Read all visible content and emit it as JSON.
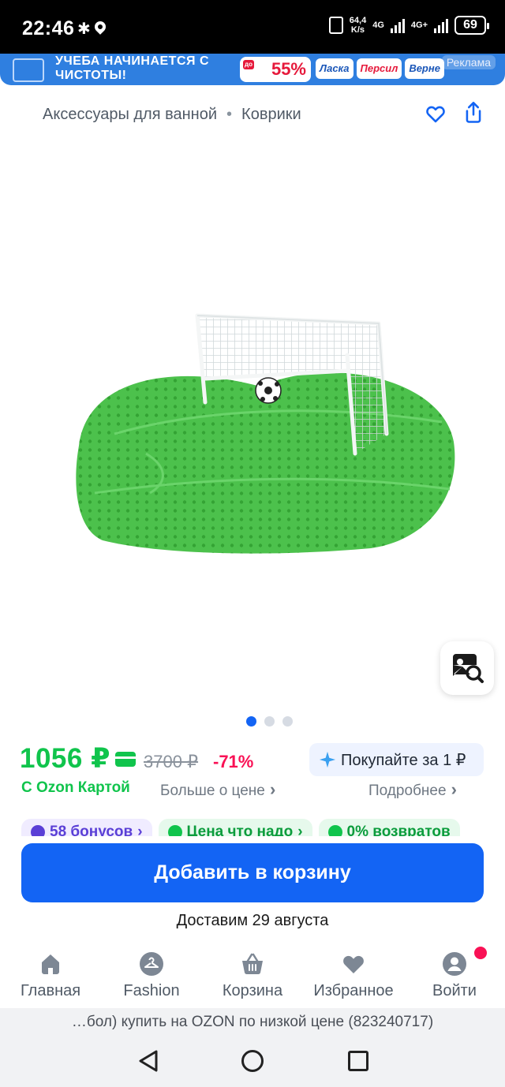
{
  "status_bar": {
    "time": "22:46",
    "net_speed_value": "64,4",
    "net_speed_unit": "K/s",
    "network1": "4G",
    "network2": "4G+",
    "battery": "69"
  },
  "ad_banner": {
    "headline": "УЧЕБА НАЧИНАЕТСЯ С ЧИСТОТЫ!",
    "promo_prefix": "до",
    "promo": "55%",
    "brands": [
      "Ласка",
      "Персил",
      "Верне"
    ],
    "label": "Реклама",
    "colors": {
      "background": "#2f7fe0",
      "promo": "#e6193b"
    }
  },
  "breadcrumb": {
    "items": [
      "Аксессуары для ванной",
      "Коврики"
    ]
  },
  "gallery": {
    "image_description_icon": "urinal-screen-football-goal",
    "dots_total": 3,
    "active_dot": 0
  },
  "price": {
    "current": "1056 ₽",
    "old": "3700 ₽",
    "discount": "-71%",
    "card_label": "С Ozon Картой",
    "more_about_price": "Больше о цене",
    "buy_for_label": "Покупайте за 1 ₽",
    "details_label": "Подробнее",
    "colors": {
      "price": "#10c44c",
      "discount": "#f91155",
      "accent": "#1364f4"
    }
  },
  "chips": [
    {
      "label": "58 бонусов",
      "style": "bonus"
    },
    {
      "label": "Цена что надо",
      "style": "good"
    },
    {
      "label": "0% возвратов",
      "style": "good"
    }
  ],
  "cart": {
    "button_label": "Добавить в корзину",
    "delivery": "Доставим 29 августа"
  },
  "bottom_nav": {
    "items": [
      {
        "label": "Главная",
        "icon": "home-icon"
      },
      {
        "label": "Fashion",
        "icon": "hanger-icon"
      },
      {
        "label": "Корзина",
        "icon": "basket-icon"
      },
      {
        "label": "Избранное",
        "icon": "heart-icon"
      },
      {
        "label": "Войти",
        "icon": "user-icon"
      }
    ]
  },
  "url_bar": {
    "text": "…бол) купить на OZON по низкой цене (823240717)"
  }
}
